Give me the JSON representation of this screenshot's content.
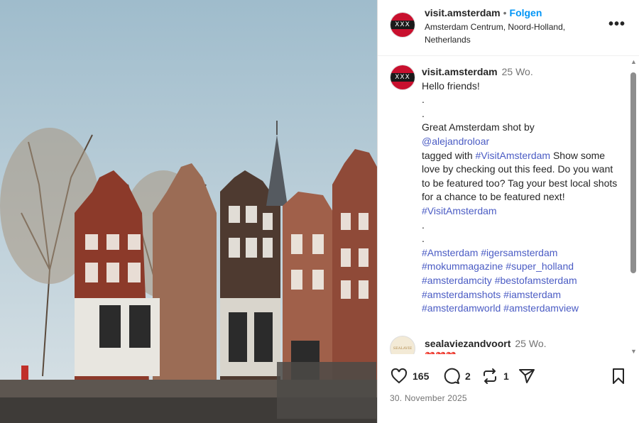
{
  "header": {
    "username": "visit.amsterdam",
    "separator": "•",
    "follow_label": "Folgen",
    "location": "Amsterdam Centrum, Noord-Holland, Netherlands",
    "more_label": "•••"
  },
  "avatar": {
    "text": "XXX"
  },
  "caption": {
    "username": "visit.amsterdam",
    "time": "25 Wo.",
    "lines": [
      "Hello friends!",
      ".",
      ".",
      "Great Amsterdam shot by"
    ],
    "mention": "@alejandroloar",
    "text1": "tagged with ",
    "tag_visit": "#VisitAmsterdam",
    "text2": " Show some love by checking out this feed. Do you want to be featured too? Tag your best local shots for a chance to be featured next! ",
    "tag_visit2": "#VisitAmsterdam",
    "dot3": ".",
    "dot4": ".",
    "hashtags": [
      "#Amsterdam",
      "#igersamsterdam",
      "#mokummagazine",
      "#super_holland",
      "#amsterdamcity",
      "#bestofamsterdam",
      "#amsterdamshots",
      "#iamsterdam",
      "#amsterdamworld",
      "#amsterdamview"
    ]
  },
  "comment": {
    "username": "sealaviezandvoort",
    "time": "25 Wo.",
    "text": "❤️❤️❤️",
    "avatar_text": "SEALAVIE"
  },
  "actions": {
    "likes": "165",
    "comments": "2",
    "reposts": "1"
  },
  "date": "30. November 2025",
  "colors": {
    "link": "#4b5cc4",
    "follow": "#0095f6",
    "text": "#262626"
  }
}
